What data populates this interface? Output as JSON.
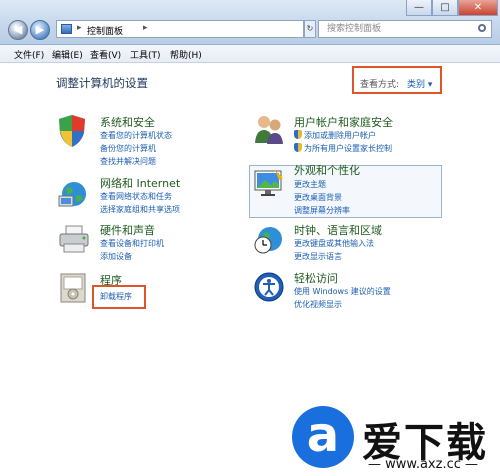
{
  "nav": {
    "back": "◀",
    "forward": "▶"
  },
  "address": {
    "crumb": "控制面板",
    "sep": "▸"
  },
  "search": {
    "placeholder": "搜索控制面板"
  },
  "window_buttons": [
    "—",
    "□",
    "✕"
  ],
  "menu": [
    "文件(F)",
    "编辑(E)",
    "查看(V)",
    "工具(T)",
    "帮助(H)"
  ],
  "header": {
    "title": "调整计算机的设置",
    "view_label": "查看方式:",
    "view_value": "类别 ▾"
  },
  "left": [
    {
      "title": "系统和安全",
      "links": [
        "查看您的计算机状态",
        "备份您的计算机",
        "查找并解决问题"
      ]
    },
    {
      "title": "网络和 Internet",
      "links": [
        "查看网络状态和任务",
        "选择家庭组和共享选项"
      ]
    },
    {
      "title": "硬件和声音",
      "links": [
        "查看设备和打印机",
        "添加设备"
      ]
    },
    {
      "title": "程序",
      "links": [
        "卸载程序"
      ]
    }
  ],
  "right": [
    {
      "title": "用户帐户和家庭安全",
      "links": [
        "添加或删除用户帐户",
        "为所有用户设置家长控制"
      ]
    },
    {
      "title": "外观和个性化",
      "links": [
        "更改主题",
        "更改桌面背景",
        "调整屏幕分辨率"
      ]
    },
    {
      "title": "时钟、语言和区域",
      "links": [
        "更改键盘或其他输入法",
        "更改显示语言"
      ]
    },
    {
      "title": "轻松访问",
      "links": [
        "使用 Windows 建议的设置",
        "优化视频显示"
      ]
    }
  ],
  "watermark": {
    "logo": "a",
    "name": "爱下载",
    "url": "— www.axz.cc —"
  }
}
